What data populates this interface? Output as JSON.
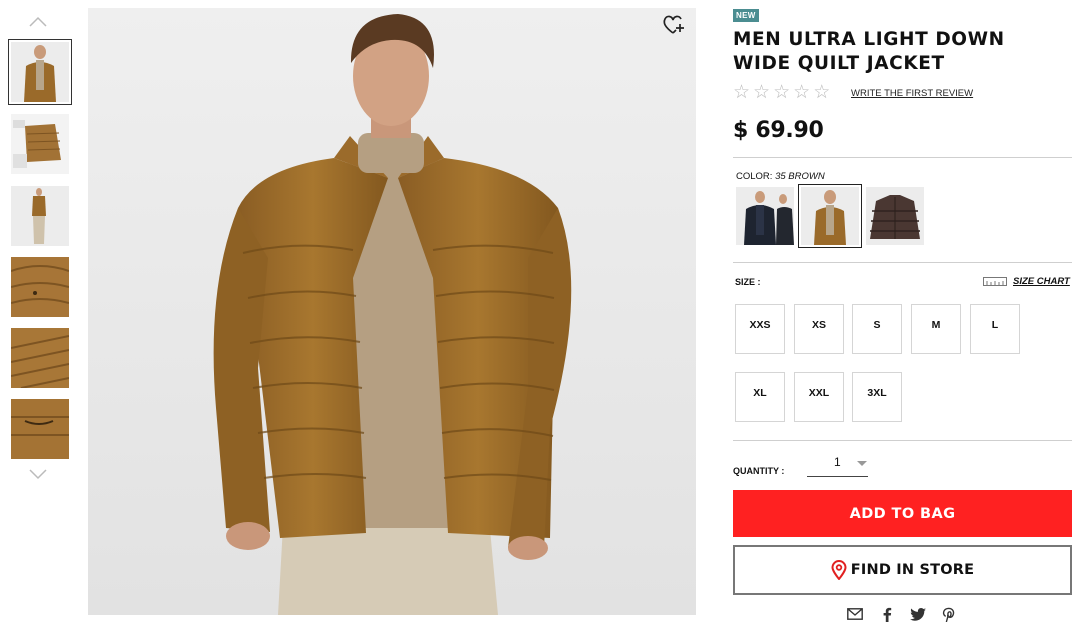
{
  "product": {
    "badge": "NEW",
    "title": "MEN ULTRA LIGHT DOWN WIDE QUILT JACKET",
    "rating_stars": 0,
    "review_link": "WRITE THE FIRST REVIEW",
    "price": "$ 69.90"
  },
  "color": {
    "label": "COLOR:",
    "selected": "35 BROWN",
    "swatches": [
      "black-swatch",
      "brown-swatch",
      "dark-brown-swatch"
    ]
  },
  "size": {
    "label": "SIZE :",
    "chart_label": "SIZE CHART",
    "options": [
      "XXS",
      "XS",
      "S",
      "M",
      "L",
      "XL",
      "XXL",
      "3XL"
    ]
  },
  "quantity": {
    "label": "QUANTITY :",
    "value": "1"
  },
  "actions": {
    "add_to_bag": "ADD TO BAG",
    "find_in_store": "FIND IN STORE"
  },
  "colors": {
    "add_button": "#ff2121",
    "badge": "#4b8d91",
    "jacket": "#9a6a2a"
  },
  "icons": [
    "chevron-up-icon",
    "chevron-down-icon",
    "wishlist-heart-plus-icon",
    "star-icon",
    "ruler-icon",
    "map-pin-icon",
    "email-icon",
    "facebook-icon",
    "twitter-icon",
    "pinterest-icon"
  ]
}
